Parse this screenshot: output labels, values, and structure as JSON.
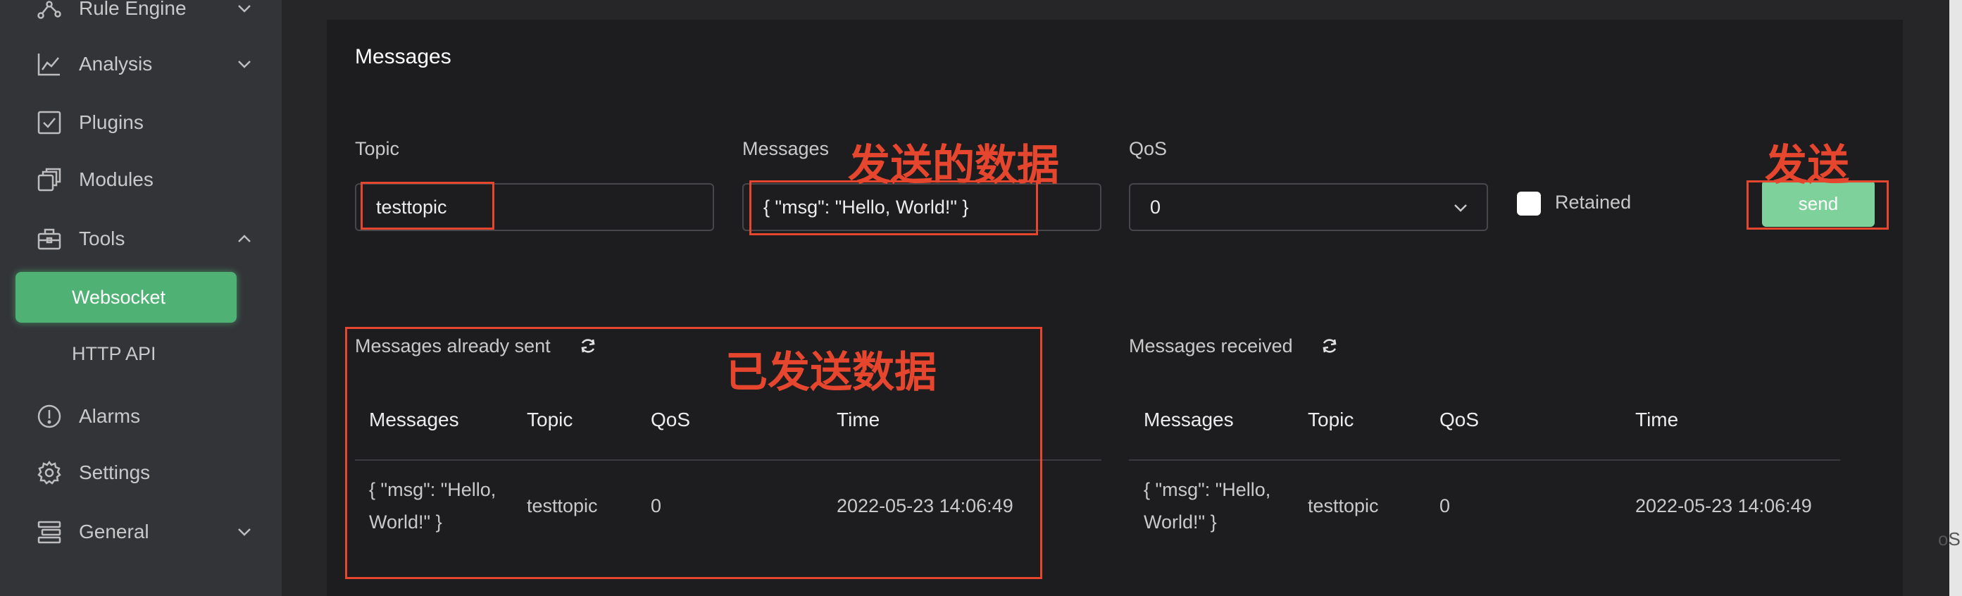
{
  "sidebar": {
    "items": [
      {
        "label": "Rule Engine",
        "icon": "rule-engine-icon",
        "chevron": "down"
      },
      {
        "label": "Analysis",
        "icon": "analysis-chart-icon",
        "chevron": "down"
      },
      {
        "label": "Plugins",
        "icon": "plugins-checkbox-icon"
      },
      {
        "label": "Modules",
        "icon": "modules-icon"
      },
      {
        "label": "Tools",
        "icon": "toolbox-icon",
        "chevron": "up"
      },
      {
        "label": "Alarms",
        "icon": "alarm-exclamation-icon"
      },
      {
        "label": "Settings",
        "icon": "settings-gear-icon"
      },
      {
        "label": "General",
        "icon": "general-stack-icon",
        "chevron": "down"
      }
    ],
    "tools_sub": [
      {
        "label": "Websocket",
        "active": true
      },
      {
        "label": "HTTP API",
        "active": false
      }
    ]
  },
  "card": {
    "title": "Messages",
    "topic_label": "Topic",
    "topic_value": "testtopic",
    "messages_label": "Messages",
    "messages_value": "{ \"msg\": \"Hello, World!\" }",
    "qos_label": "QoS",
    "qos_value": "0",
    "retained_label": "Retained",
    "send_label": "send"
  },
  "sent": {
    "title": "Messages already sent",
    "headers": [
      "Messages",
      "Topic",
      "QoS",
      "Time"
    ],
    "rows": [
      {
        "message_line1": "{ \"msg\": \"Hello,",
        "message_line2": "World!\" }",
        "topic": "testtopic",
        "qos": "0",
        "time": "2022-05-23 14:06:49"
      }
    ]
  },
  "received": {
    "title": "Messages received",
    "headers": [
      "Messages",
      "Topic",
      "QoS",
      "Time"
    ],
    "rows": [
      {
        "message_line1": "{ \"msg\": \"Hello,",
        "message_line2": "World!\" }",
        "topic": "testtopic",
        "qos": "0",
        "time": "2022-05-23 14:06:49"
      }
    ]
  },
  "annotations": {
    "data_to_send": "发送的数据",
    "send": "发送",
    "sent_data": "已发送数据",
    "color": "#e6452e"
  },
  "edge_text": "oS",
  "colors": {
    "accent_green": "#4fb174",
    "send_button": "#7fd19c",
    "sidebar_bg": "#333438",
    "card_bg": "#1d1d1f"
  }
}
